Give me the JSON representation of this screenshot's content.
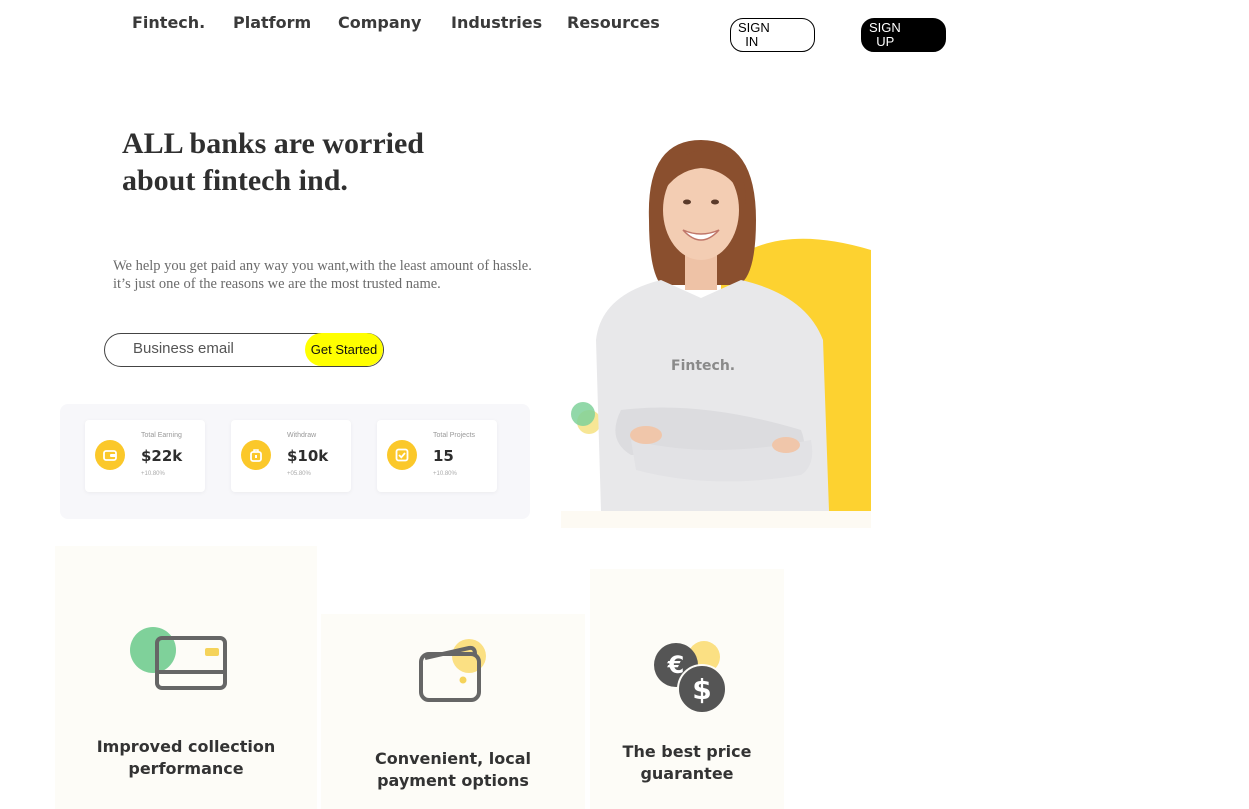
{
  "nav": {
    "logo": "Fintech.",
    "links": [
      "Platform",
      "Company",
      "Industries",
      "Resources"
    ],
    "sign_in": "SIGN\n  IN",
    "sign_up": "SIGN\n  UP"
  },
  "hero": {
    "title": "ALL banks are worried about fintech ind.",
    "subtitle": "We help you get paid any way you want,with the least amount of hassle. it’s just one of the reasons we are the most trusted name.",
    "email_placeholder": "Business email",
    "cta": "Get Started",
    "image_logo": "Fintech."
  },
  "stats": [
    {
      "label": "Total Earning",
      "value": "$22k",
      "change": "+10.80%",
      "icon": "wallet-icon"
    },
    {
      "label": "Withdraw",
      "value": "$10k",
      "change": "+05.80%",
      "icon": "bag-icon"
    },
    {
      "label": "Total Projects",
      "value": "15",
      "change": "+10.80%",
      "icon": "checkbox-icon"
    }
  ],
  "features": [
    {
      "title": "Improved collection\nperformance",
      "icon": "credit-card-icon"
    },
    {
      "title": "Convenient, local\npayment options",
      "icon": "wallet-icon"
    },
    {
      "title": "The best price\nguarantee",
      "icon": "currency-coins-icon"
    }
  ],
  "colors": {
    "accent_yellow": "#ffff00",
    "brand_yellow": "#fbc82a",
    "accent_green": "#5fc48a",
    "dark": "#000000"
  }
}
